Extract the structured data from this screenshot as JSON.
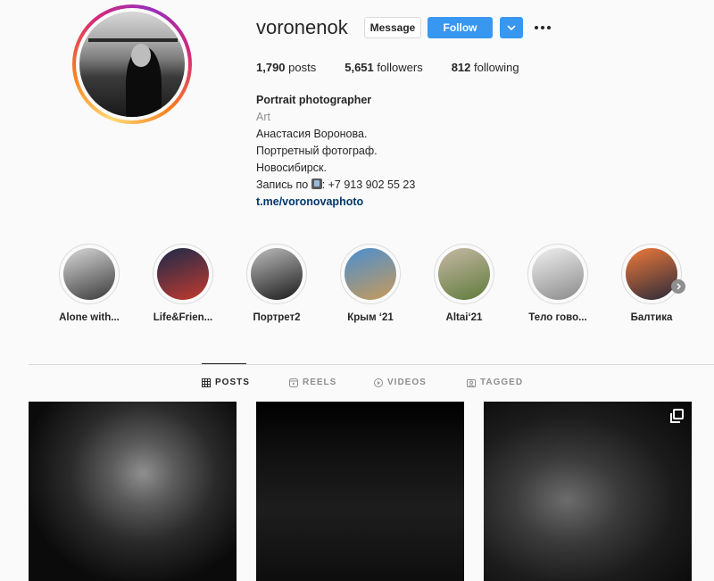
{
  "profile": {
    "username": "voronenok",
    "buttons": {
      "message": "Message",
      "follow": "Follow"
    },
    "stats": {
      "posts_count": "1,790",
      "posts_label": " posts",
      "followers_count": "5,651",
      "followers_label": " followers",
      "following_count": "812",
      "following_label": " following"
    },
    "bio": {
      "name": "Portrait photographer",
      "category": "Art",
      "line1": "Анастасия Воронова.",
      "line2": "Портретный фотограф.",
      "line3": "Новосибирск.",
      "line4_prefix": "Запись по ",
      "line4_suffix": ": +7 913 902 55 23",
      "link": "t.me/voronovaphoto"
    }
  },
  "highlights": [
    {
      "label": "Alone with...",
      "icon": "highlight-cover",
      "colors": [
        "#d9d9d9",
        "#3a3a3a"
      ]
    },
    {
      "label": "Life&Frien...",
      "icon": "highlight-cover",
      "colors": [
        "#1b2a4a",
        "#c43a2e"
      ]
    },
    {
      "label": "Портрет2",
      "icon": "highlight-cover",
      "colors": [
        "#bdbdbd",
        "#1a1a1a"
      ]
    },
    {
      "label": "Крым ‘21",
      "icon": "highlight-cover",
      "colors": [
        "#4a8fd0",
        "#c89a5a"
      ]
    },
    {
      "label": "Altai‘21",
      "icon": "highlight-cover",
      "colors": [
        "#c6b9a6",
        "#5f7a3a"
      ]
    },
    {
      "label": "Тело гово...",
      "icon": "highlight-cover",
      "colors": [
        "#f0f0f0",
        "#8a8a8a"
      ]
    },
    {
      "label": "Балтика",
      "icon": "highlight-cover",
      "colors": [
        "#f07a3a",
        "#2a2a3a"
      ]
    }
  ],
  "tabs": [
    {
      "label": "POSTS",
      "icon": "grid-icon",
      "active": true
    },
    {
      "label": "REELS",
      "icon": "reels-icon",
      "active": false
    },
    {
      "label": "VIDEOS",
      "icon": "play-icon",
      "active": false
    },
    {
      "label": "TAGGED",
      "icon": "tag-icon",
      "active": false
    }
  ],
  "posts": [
    {
      "icon": "photo"
    },
    {
      "icon": "photo"
    },
    {
      "icon": "photo",
      "badge": "carousel-icon"
    }
  ],
  "colors": {
    "accent": "#3897f0",
    "link": "#00376b",
    "muted": "#8e8e8e"
  }
}
